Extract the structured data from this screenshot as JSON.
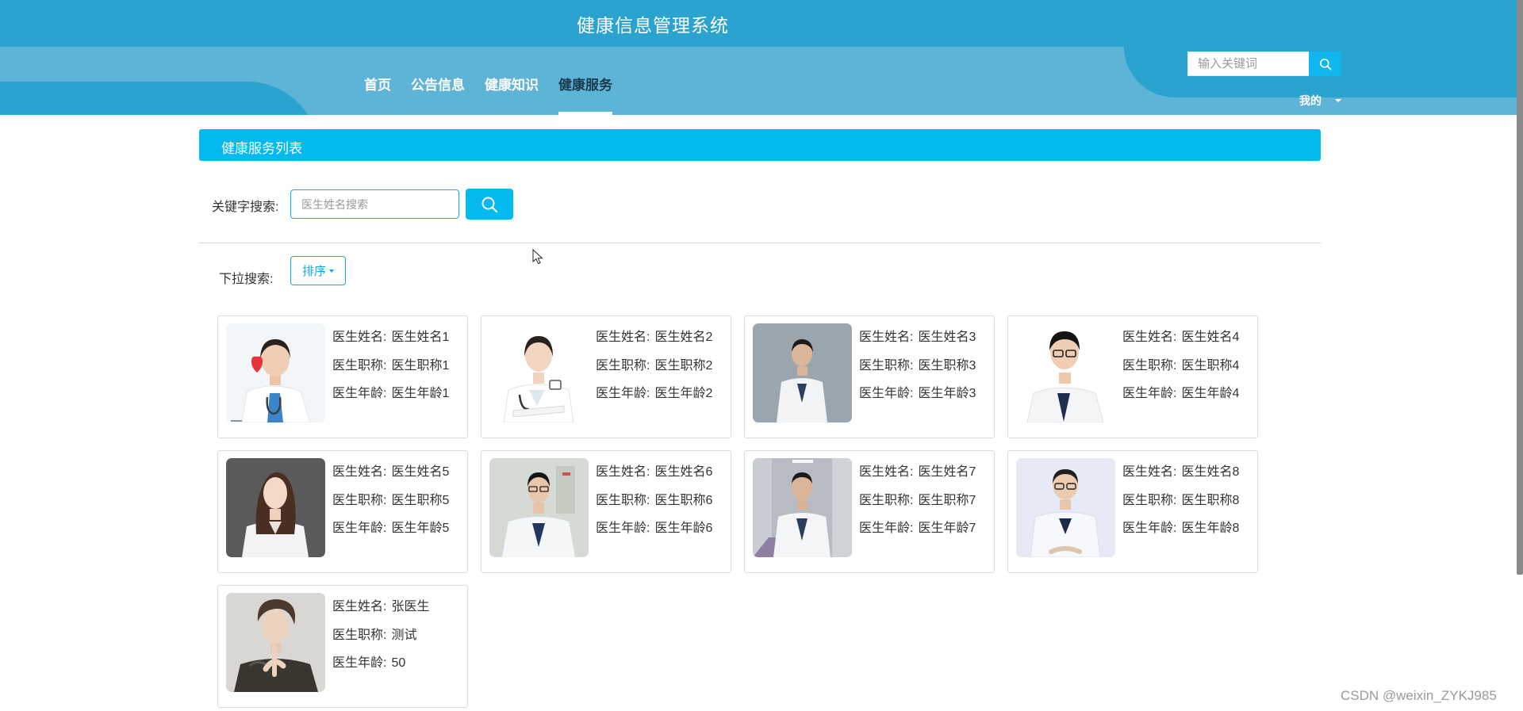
{
  "header": {
    "title": "健康信息管理系统",
    "nav": [
      {
        "label": "首页",
        "active": false
      },
      {
        "label": "公告信息",
        "active": false
      },
      {
        "label": "健康知识",
        "active": false
      },
      {
        "label": "健康服务",
        "active": true
      }
    ],
    "search_placeholder": "输入关键词",
    "search_icon": "search-icon",
    "user_menu_label": "我的"
  },
  "section": {
    "title": "健康服务列表"
  },
  "filters": {
    "keyword_label": "关键字搜索:",
    "keyword_placeholder": "医生姓名搜索",
    "keyword_value": "",
    "search_icon": "search-icon",
    "dropdown_label": "下拉搜索:",
    "sort_label": "排序"
  },
  "doctors": [
    {
      "name_label": "医生姓名:",
      "name": "医生姓名1",
      "title_label": "医生职称:",
      "title": "医生职称1",
      "age_label": "医生年龄:",
      "age": "医生年龄1"
    },
    {
      "name_label": "医生姓名:",
      "name": "医生姓名2",
      "title_label": "医生职称:",
      "title": "医生职称2",
      "age_label": "医生年龄:",
      "age": "医生年龄2"
    },
    {
      "name_label": "医生姓名:",
      "name": "医生姓名3",
      "title_label": "医生职称:",
      "title": "医生职称3",
      "age_label": "医生年龄:",
      "age": "医生年龄3"
    },
    {
      "name_label": "医生姓名:",
      "name": "医生姓名4",
      "title_label": "医生职称:",
      "title": "医生职称4",
      "age_label": "医生年龄:",
      "age": "医生年龄4"
    },
    {
      "name_label": "医生姓名:",
      "name": "医生姓名5",
      "title_label": "医生职称:",
      "title": "医生职称5",
      "age_label": "医生年龄:",
      "age": "医生年龄5"
    },
    {
      "name_label": "医生姓名:",
      "name": "医生姓名6",
      "title_label": "医生职称:",
      "title": "医生职称6",
      "age_label": "医生年龄:",
      "age": "医生年龄6"
    },
    {
      "name_label": "医生姓名:",
      "name": "医生姓名7",
      "title_label": "医生职称:",
      "title": "医生职称7",
      "age_label": "医生年龄:",
      "age": "医生年龄7"
    },
    {
      "name_label": "医生姓名:",
      "name": "医生姓名8",
      "title_label": "医生职称:",
      "title": "医生职称8",
      "age_label": "医生年龄:",
      "age": "医生年龄8"
    },
    {
      "name_label": "医生姓名:",
      "name": "张医生",
      "title_label": "医生职称:",
      "title": "测试",
      "age_label": "医生年龄:",
      "age": "50"
    }
  ],
  "watermark": "CSDN @weixin_ZYKJ985",
  "colors": {
    "header_dark": "#2ba3cf",
    "header_light": "#5db4d6",
    "accent": "#04b9ef"
  }
}
